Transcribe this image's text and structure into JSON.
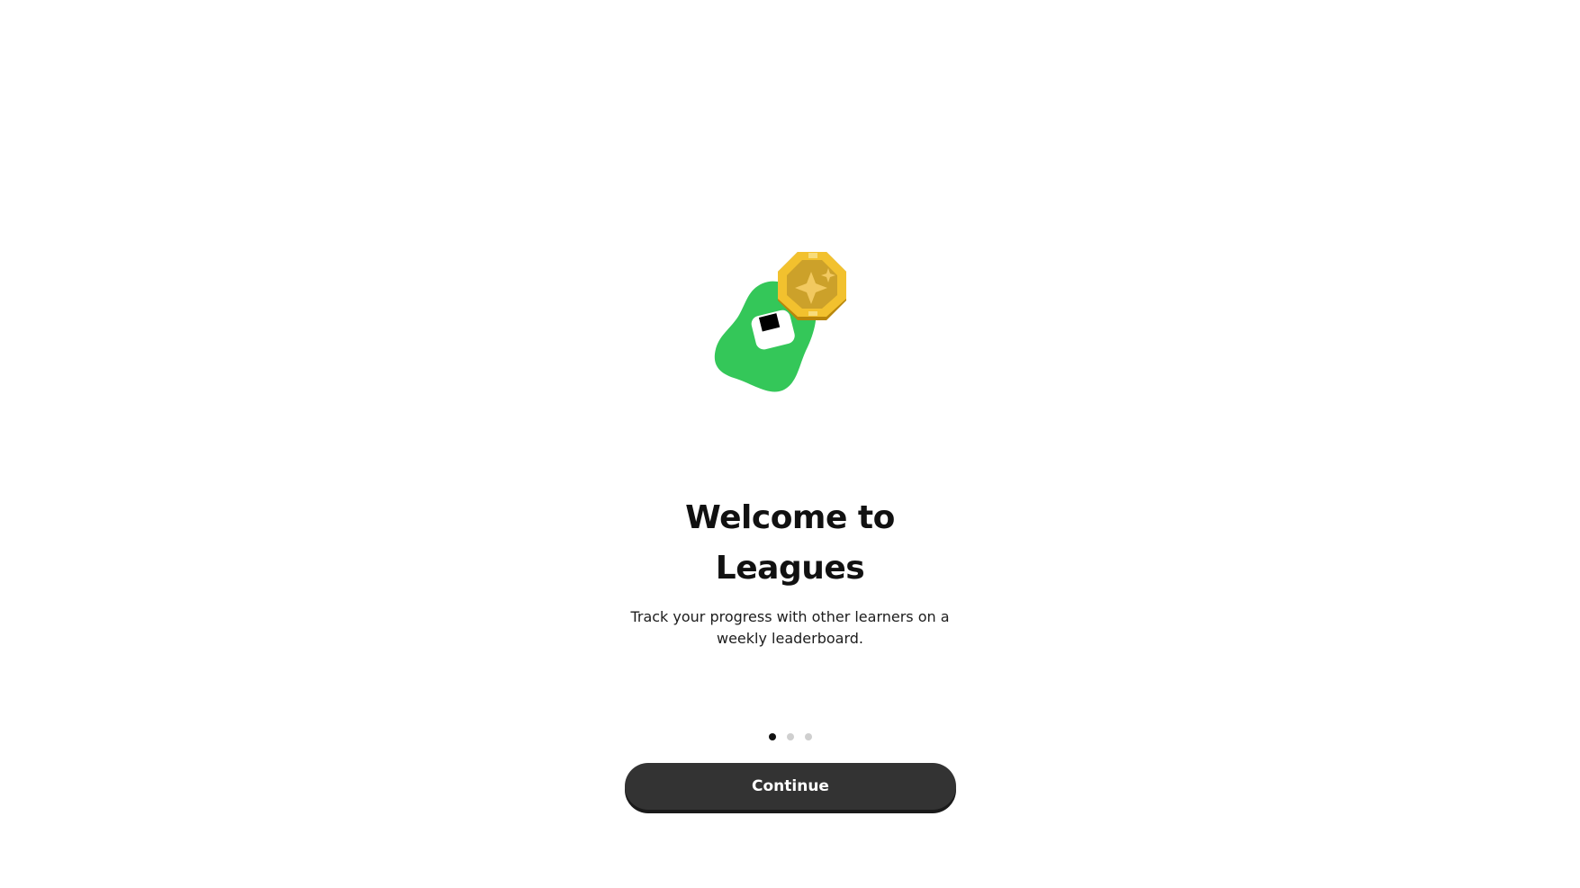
{
  "onboarding": {
    "title_line1": "Welcome to",
    "title_line2": "Leagues",
    "subtitle": "Track your progress with other learners on a weekly leaderboard.",
    "continue_label": "Continue",
    "pager": {
      "total_pages": 3,
      "current_page": 1
    }
  },
  "colors": {
    "mascot_green": "#34C759",
    "badge_gold": "#E8B923",
    "badge_inner": "#C9A227",
    "button_bg": "#333333",
    "active_dot": "#111111",
    "inactive_dot": "#CFCFCF"
  },
  "icons": {
    "mascot": "green-blob-mascot-icon",
    "badge": "gold-octagon-star-badge-icon"
  }
}
